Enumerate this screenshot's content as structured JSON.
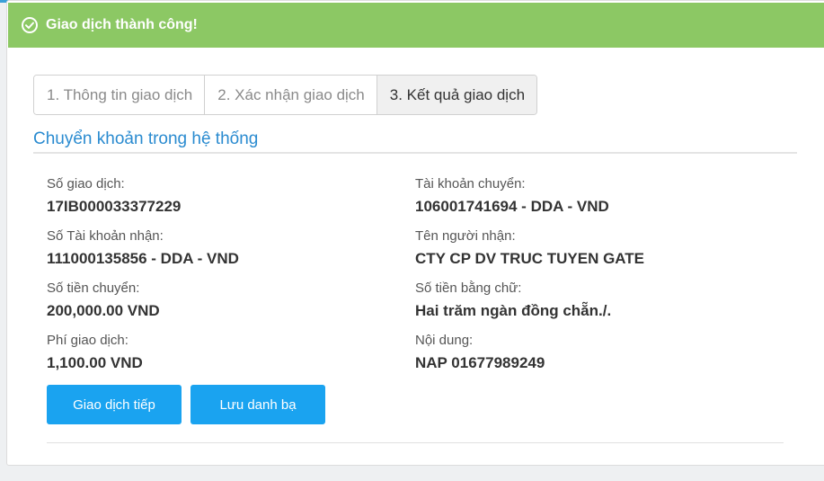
{
  "banner": {
    "icon": "check-circle-icon",
    "message": "Giao dịch thành công!",
    "color": "#8cc864"
  },
  "steps": [
    {
      "label": "1. Thông tin giao dịch",
      "active": false
    },
    {
      "label": "2. Xác nhận giao dịch",
      "active": false
    },
    {
      "label": "3. Kết quả giao dịch",
      "active": true
    }
  ],
  "section": {
    "title": "Chuyển khoản trong hệ thống"
  },
  "details": {
    "transaction_no": {
      "label": "Số giao dịch:",
      "value": "17IB000033377229"
    },
    "source_account": {
      "label": "Tài khoản chuyển:",
      "value": "106001741694 - DDA - VND"
    },
    "receiver_account": {
      "label": "Số Tài khoản nhận:",
      "value": "111000135856 - DDA - VND"
    },
    "receiver_name": {
      "label": "Tên người nhận:",
      "value": "CTY CP DV TRUC TUYEN GATE"
    },
    "amount": {
      "label": "Số tiền chuyển:",
      "value": "200,000.00 VND"
    },
    "amount_words": {
      "label": "Số tiền bằng chữ:",
      "value": "Hai trăm ngàn đồng chẵn./."
    },
    "fee": {
      "label": "Phí giao dịch:",
      "value": "1,100.00 VND"
    },
    "content": {
      "label": "Nội dung:",
      "value": "NAP 01677989249"
    }
  },
  "actions": {
    "continue_label": "Giao dịch tiếp",
    "save_contact_label": "Lưu danh bạ",
    "button_color": "#1aa3f0"
  }
}
